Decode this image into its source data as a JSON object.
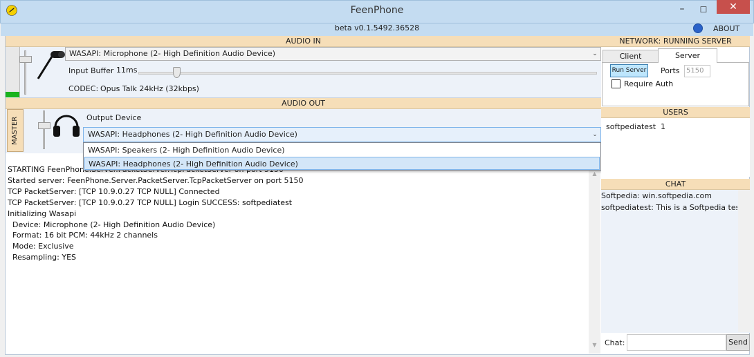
{
  "window": {
    "title": "FeenPhone",
    "version": "beta v0.1.5492.36528",
    "about": "ABOUT",
    "min_glyph": "–",
    "max_glyph": "☐",
    "close_glyph": "✕"
  },
  "audio_in": {
    "header": "AUDIO IN",
    "device": "WASAPI: Microphone (2- High Definition Audio Device)",
    "input_buffer_label": "Input Buffer",
    "input_buffer_value": "11ms",
    "codec_label": "CODEC:",
    "codec_value": "Opus Talk 24kHz (32kbps)"
  },
  "audio_out": {
    "header": "AUDIO OUT",
    "master_label": "MASTER",
    "output_device_label": "Output Device",
    "device": "WASAPI: Headphones (2- High Definition Audio Device)",
    "dropdown_options": [
      "WASAPI: Speakers (2- High Definition Audio Device)",
      "WASAPI: Headphones (2- High Definition Audio Device)"
    ]
  },
  "log": [
    "STARTING FeenPhone.Server.PacketServer.TcpPacketServer on port 5150",
    "Started server: FeenPhone.Server.PacketServer.TcpPacketServer on port 5150",
    "TCP PacketServer: [TCP 10.9.0.27 TCP NULL] Connected",
    "TCP PacketServer: [TCP 10.9.0.27 TCP NULL] Login SUCCESS: softpediatest",
    "Initializing Wasapi",
    "  Device: Microphone (2- High Definition Audio Device)",
    "  Format: 16 bit PCM: 44kHz 2 channels",
    "  Mode: Exclusive",
    "  Resampling: YES"
  ],
  "network": {
    "header": "NETWORK: RUNNING SERVER",
    "tabs": [
      "Client",
      "Server"
    ],
    "run_server": "Run Server",
    "ports_label": "Ports",
    "ports_value": "5150",
    "require_auth": "Require Auth"
  },
  "users": {
    "header": "USERS",
    "list": [
      {
        "name": "softpediatest",
        "count": "1"
      }
    ]
  },
  "chat": {
    "header": "CHAT",
    "messages": [
      "Softpedia: win.softpedia.com",
      "softpediatest: This is a Softpedia test,"
    ],
    "input_label": "Chat:",
    "send": "Send"
  }
}
